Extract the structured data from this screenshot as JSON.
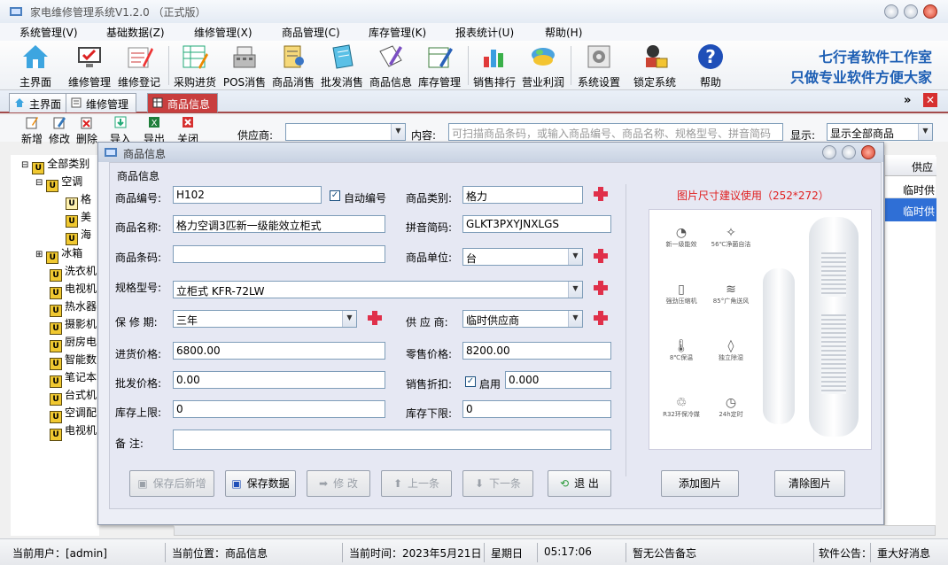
{
  "app": {
    "title": "家电维修管理系统V1.2.0 （正式版）"
  },
  "menu": [
    "系统管理(V)",
    "基础数据(Z)",
    "维修管理(X)",
    "商品管理(C)",
    "库存管理(K)",
    "报表统计(U)",
    "帮助(H)"
  ],
  "toolbar": [
    "主界面",
    "维修管理",
    "维修登记",
    "采购进货",
    "POS消售",
    "商品消售",
    "批发消售",
    "商品信息",
    "库存管理",
    "销售排行",
    "营业利润",
    "系统设置",
    "锁定系统",
    "帮助"
  ],
  "slogan": {
    "line1": "七行者软件工作室",
    "line2": "只做专业软件方便大家"
  },
  "tabs": [
    "主界面",
    "维修管理",
    "商品信息"
  ],
  "subbar": {
    "buttons": [
      "新增",
      "修改",
      "删除",
      "导入",
      "导出",
      "关闭"
    ],
    "supplier_label": "供应商:",
    "content_label": "内容:",
    "content_placeholder": "可扫描商品条码，或输入商品编号、商品名称、规格型号、拼音简码",
    "display_label": "显示:",
    "display_value": "显示全部商品"
  },
  "tree": {
    "root": "全部类别",
    "nodes": [
      "空调",
      "格",
      "美",
      "海",
      "冰箱",
      "洗衣机",
      "电视机",
      "热水器",
      "摄影机",
      "厨房电",
      "智能数",
      "笔记本",
      "台式机",
      "空调配",
      "电视机"
    ]
  },
  "grid": {
    "header": "供应",
    "rows": [
      "临时供",
      "临时供"
    ]
  },
  "dialog": {
    "title": "商品信息",
    "group": "商品信息",
    "labels": {
      "code": "商品编号:",
      "auto": "自动编号",
      "category": "商品类别:",
      "name": "商品名称:",
      "pinyin": "拼音简码:",
      "barcode": "商品条码:",
      "unit": "商品单位:",
      "spec": "规格型号:",
      "warranty": "保 修 期:",
      "supplier": "供 应 商:",
      "purchase": "进货价格:",
      "retail": "零售价格:",
      "wholesale": "批发价格:",
      "discount": "销售折扣:",
      "enable": "启用",
      "upper": "库存上限:",
      "lower": "库存下限:",
      "remark": "备    注:"
    },
    "values": {
      "code": "H102",
      "category": "格力",
      "name": "格力空调3匹新一级能效立柜式",
      "pinyin": "GLKT3PXYJNXLGS",
      "barcode": "",
      "unit": "台",
      "spec": "立柜式 KFR-72LW",
      "warranty": "三年",
      "supplier": "临时供应商",
      "purchase": "6800.00",
      "retail": "8200.00",
      "wholesale": "0.00",
      "discount": "0.000",
      "upper": "0",
      "lower": "0",
      "remark": ""
    },
    "image_hint": "图片尺寸建议使用（252*272）",
    "image_features": [
      "新一级能效",
      "56℃净菌自洁",
      "强劲压缩机",
      "85°广角送风",
      "8℃保温",
      "独立除湿",
      "R32环保冷媒",
      "24h定时"
    ],
    "buttons": {
      "save_new": "保存后新增",
      "save": "保存数据",
      "edit": "修 改",
      "prev": "上一条",
      "next": "下一条",
      "exit": "退 出",
      "add_image": "添加图片",
      "clear_image": "清除图片"
    }
  },
  "status": {
    "user": "当前用户：[admin]",
    "position": "当前位置：商品信息",
    "time_label": "当前时间：2023年5月21日",
    "weekday": "星期日",
    "clock": "05:17:06",
    "notice": "暂无公告备忘",
    "software_notice": "软件公告：",
    "news": "重大好消息"
  },
  "colors": {
    "accent": "#c83e3e",
    "brand": "#1e5fb4",
    "hint": "#e02020"
  }
}
